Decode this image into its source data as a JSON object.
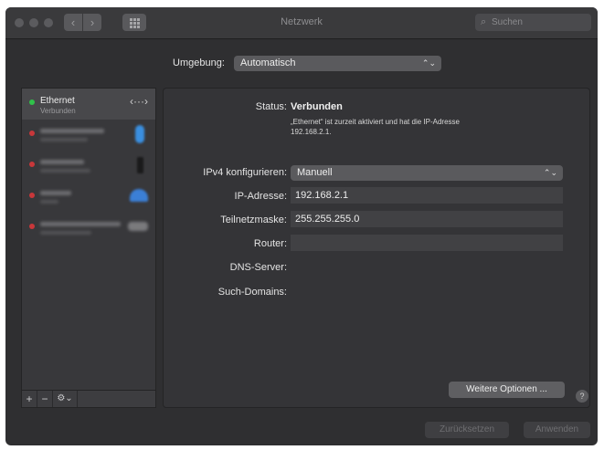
{
  "window": {
    "title": "Netzwerk"
  },
  "toolbar": {
    "back": "‹",
    "forward": "›"
  },
  "search": {
    "placeholder": "Suchen"
  },
  "location": {
    "label": "Umgebung:",
    "value": "Automatisch"
  },
  "services": [
    {
      "name": "Ethernet",
      "status": "Verbunden",
      "dot_color": "#30c24a",
      "icon": "ethernet-arrows-icon"
    },
    {
      "dot_color": "#c8373a",
      "icon": "bluetooth-icon"
    },
    {
      "dot_color": "#c8373a",
      "icon": "phone-icon"
    },
    {
      "dot_color": "#c8373a",
      "icon": "wifi-icon"
    },
    {
      "dot_color": "#c8373a",
      "icon": "thunderbolt-bridge-icon"
    }
  ],
  "sidebar_tools": {
    "add": "+",
    "remove": "−",
    "action": "⚙︎⌄"
  },
  "detail": {
    "status_label": "Status:",
    "status_value": "Verbunden",
    "status_desc_1": "„Ethernet“ ist zurzeit aktiviert und hat die IP-Adresse",
    "status_desc_2": "192.168.2.1.",
    "ipv4_label": "IPv4 konfigurieren:",
    "ipv4_value": "Manuell",
    "ip_label": "IP-Adresse:",
    "ip_value": "192.168.2.1",
    "subnet_label": "Teilnetzmaske:",
    "subnet_value": "255.255.255.0",
    "router_label": "Router:",
    "router_value": "",
    "dns_label": "DNS-Server:",
    "domains_label": "Such-Domains:",
    "advanced_button": "Weitere Optionen ...",
    "help": "?"
  },
  "footer": {
    "revert": "Zurücksetzen",
    "apply": "Anwenden"
  },
  "colors": {
    "window_bg": "#2f2f31",
    "connected": "#30c24a",
    "disconnected": "#c8373a",
    "bluetooth": "#3a8fe0",
    "wifi": "#3b7fd6"
  }
}
